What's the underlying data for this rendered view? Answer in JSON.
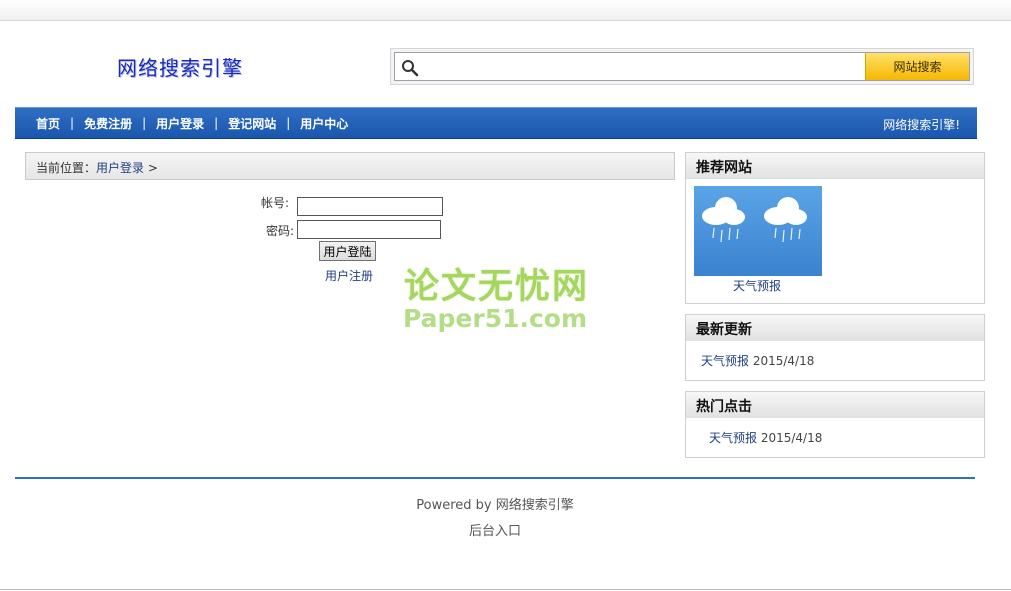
{
  "site": {
    "logo_text": "网络搜索引擎"
  },
  "search": {
    "placeholder": "",
    "button_label": "网站搜索"
  },
  "nav": {
    "items": [
      "首页",
      "免费注册",
      "用户登录",
      "登记网站",
      "用户中心"
    ],
    "separator": "|",
    "right_text": "网络搜索引擎!"
  },
  "breadcrumb": {
    "prefix": "当前位置：",
    "current": "用户登录",
    "suffix": " >"
  },
  "login": {
    "account_label": "帐号:",
    "password_label": "密码:",
    "submit_label": "用户登陆",
    "register_link": "用户注册"
  },
  "watermark": {
    "text_cn": "论文无忧网",
    "text_en": "Paper51.com"
  },
  "recommend": {
    "title": "推荐网站",
    "items": [
      {
        "name": "天气预报",
        "image": "weather-rain-clouds-image"
      }
    ]
  },
  "latest": {
    "title": "最新更新",
    "items": [
      {
        "name": "天气预报",
        "date": "2015/4/18"
      }
    ]
  },
  "hot": {
    "title": "热门点击",
    "items": [
      {
        "name": "天气预报",
        "date": "2015/4/18"
      }
    ]
  },
  "footer": {
    "powered": "Powered by 网络搜索引擎",
    "admin": "后台入口"
  },
  "colors": {
    "nav_blue": "#1a56ad",
    "search_button": "#f6b800",
    "link": "#1f3f86",
    "logo": "#1d2bb0",
    "watermark_green": "#9bd24f"
  }
}
